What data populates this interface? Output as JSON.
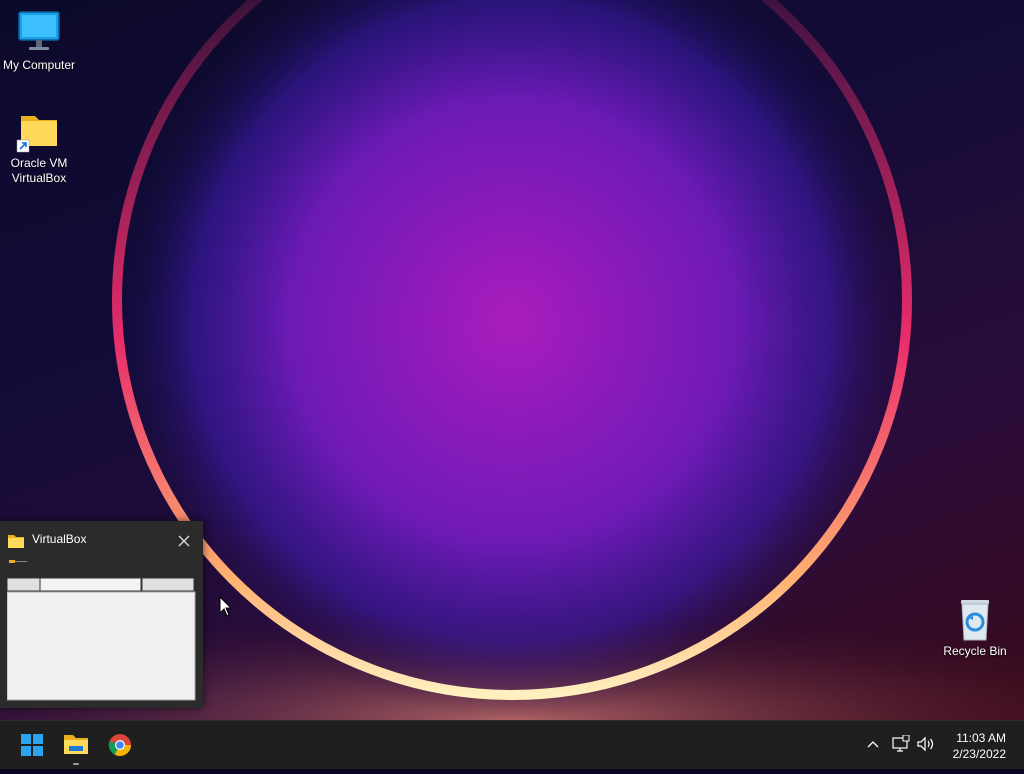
{
  "desktop": {
    "icons": [
      {
        "label": "My Computer",
        "icon": "monitor-icon"
      },
      {
        "label_line1": "Oracle VM",
        "label_line2": "VirtualBox",
        "icon": "folder-shortcut-icon"
      },
      {
        "label": "Recycle Bin",
        "icon": "recycle-bin-icon"
      }
    ]
  },
  "flyout": {
    "title": "VirtualBox",
    "icon": "folder-icon",
    "close_icon": "close-icon"
  },
  "taskbar": {
    "start_icon": "windows-logo-icon",
    "pinned": [
      {
        "icon": "file-explorer-icon",
        "active": true
      },
      {
        "icon": "chrome-icon",
        "active": false
      }
    ],
    "tray": {
      "chevron_icon": "chevron-up-icon",
      "network_icon": "network-icon",
      "volume_icon": "volume-icon"
    },
    "clock": {
      "time": "11:03 AM",
      "date": "2/23/2022"
    }
  },
  "colors": {
    "accent": "#0078d4",
    "taskbar": "#1f1f1f",
    "flyout": "#2b2b2b"
  }
}
